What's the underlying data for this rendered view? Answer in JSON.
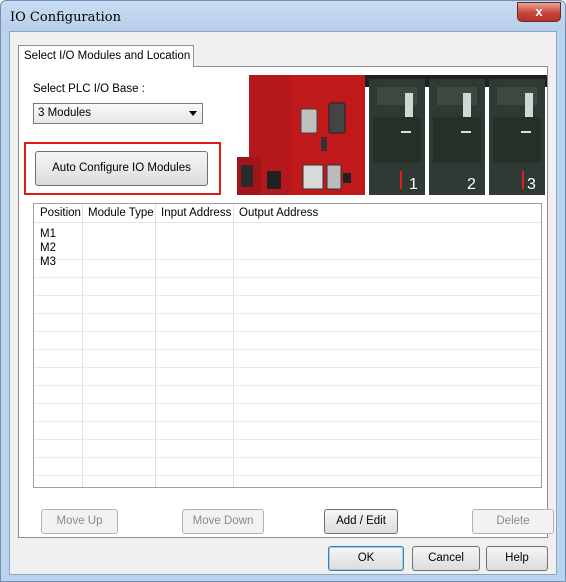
{
  "window": {
    "title": "IO Configuration",
    "close_glyph": "x"
  },
  "tab": {
    "label": "Select I/O Modules and Location"
  },
  "base": {
    "label": "Select PLC I/O Base :",
    "selected": "3 Modules"
  },
  "auto_configure": {
    "label": "Auto Configure IO Modules"
  },
  "plc": {
    "slot_numbers": [
      "1",
      "2",
      "3"
    ]
  },
  "table": {
    "columns": [
      "Position",
      "Module Type",
      "Input Address",
      "Output Address"
    ],
    "rows": [
      {
        "position": "M1",
        "module_type": "",
        "input_address": "",
        "output_address": ""
      },
      {
        "position": "M2",
        "module_type": "",
        "input_address": "",
        "output_address": ""
      },
      {
        "position": "M3",
        "module_type": "",
        "input_address": "",
        "output_address": ""
      }
    ]
  },
  "actions": {
    "move_up": "Move Up",
    "move_down": "Move Down",
    "add_edit": "Add / Edit",
    "delete": "Delete"
  },
  "footer": {
    "ok": "OK",
    "cancel": "Cancel",
    "help": "Help"
  },
  "colors": {
    "highlight": "#e01818",
    "plc_red": "#c0191c",
    "module_dark": "#2e3a33"
  },
  "icons": {
    "close": "close-icon",
    "dropdown": "chevron-down-icon"
  }
}
